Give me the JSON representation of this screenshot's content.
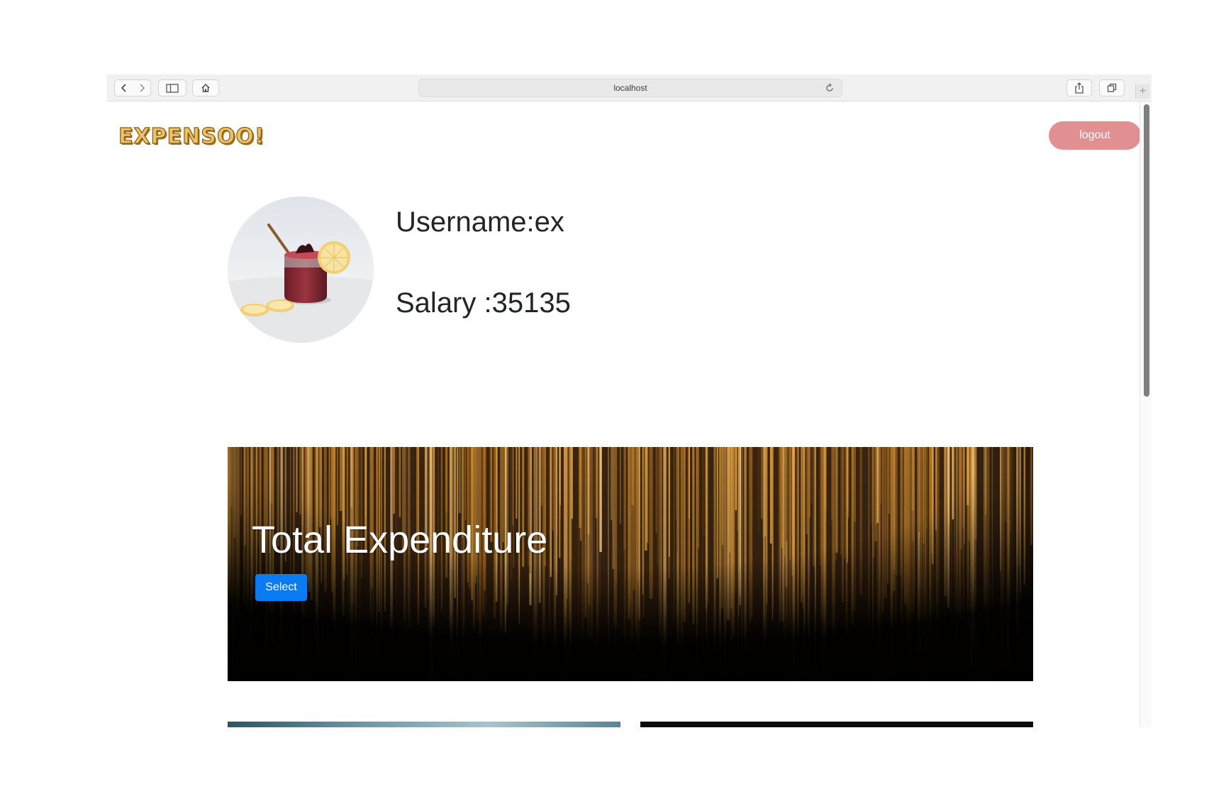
{
  "browser": {
    "address_text": "localhost",
    "new_tab_symbol": "+",
    "icons": [
      "back-arrow-icon",
      "forward-arrow-icon",
      "sidebar-icon",
      "home-icon",
      "reload-icon",
      "share-icon",
      "tabs-icon"
    ]
  },
  "header": {
    "logo_text": "EXPENSOO!",
    "logout_label": "logout"
  },
  "profile": {
    "username_label": "Username:",
    "username_value": "ex",
    "salary_label": "Salary :",
    "salary_value": "35135"
  },
  "hero": {
    "title": "Total Expenditure",
    "select_label": "Select"
  },
  "colors": {
    "logo_fill": "#e9c26a",
    "logout_bg": "#e28f91",
    "select_bg": "#0a7bf0",
    "hero_gold": "#c98a2e"
  }
}
